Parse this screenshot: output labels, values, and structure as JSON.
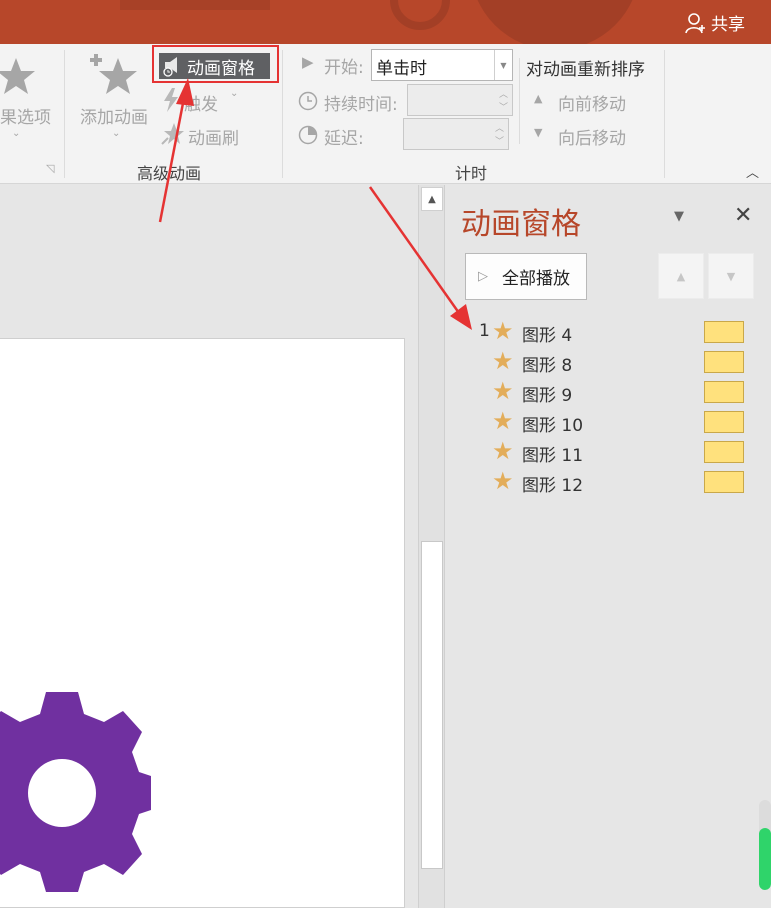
{
  "titlebar": {
    "share_label": "共享"
  },
  "ribbon": {
    "effect_options": {
      "label": "果选项"
    },
    "add_animation": {
      "label": "添加动画"
    },
    "animation_pane_btn": {
      "label": "动画窗格"
    },
    "trigger": {
      "label": "触发"
    },
    "anim_painter": {
      "label": "动画刷"
    },
    "advanced_group_label": "高级动画",
    "start": {
      "label": "开始:",
      "value": "单击时"
    },
    "duration": {
      "label": "持续时间:",
      "value": ""
    },
    "delay": {
      "label": "延迟:",
      "value": ""
    },
    "timing_group_label": "计时",
    "reorder": {
      "title": "对动画重新排序",
      "move_earlier": "向前移动",
      "move_later": "向后移动"
    }
  },
  "pane": {
    "title": "动画窗格",
    "play_all": "全部播放",
    "items": [
      {
        "num": "1",
        "name": "图形 4"
      },
      {
        "num": "",
        "name": "图形 8"
      },
      {
        "num": "",
        "name": "图形 9"
      },
      {
        "num": "",
        "name": "图形 10"
      },
      {
        "num": "",
        "name": "图形 11"
      },
      {
        "num": "",
        "name": "图形 12"
      }
    ]
  },
  "colors": {
    "accent": "#b7472a",
    "highlight_box": "#e53333",
    "timeline_bar": "#ffe17d",
    "star": "#e3ad5a",
    "gear": "#7030a0"
  }
}
